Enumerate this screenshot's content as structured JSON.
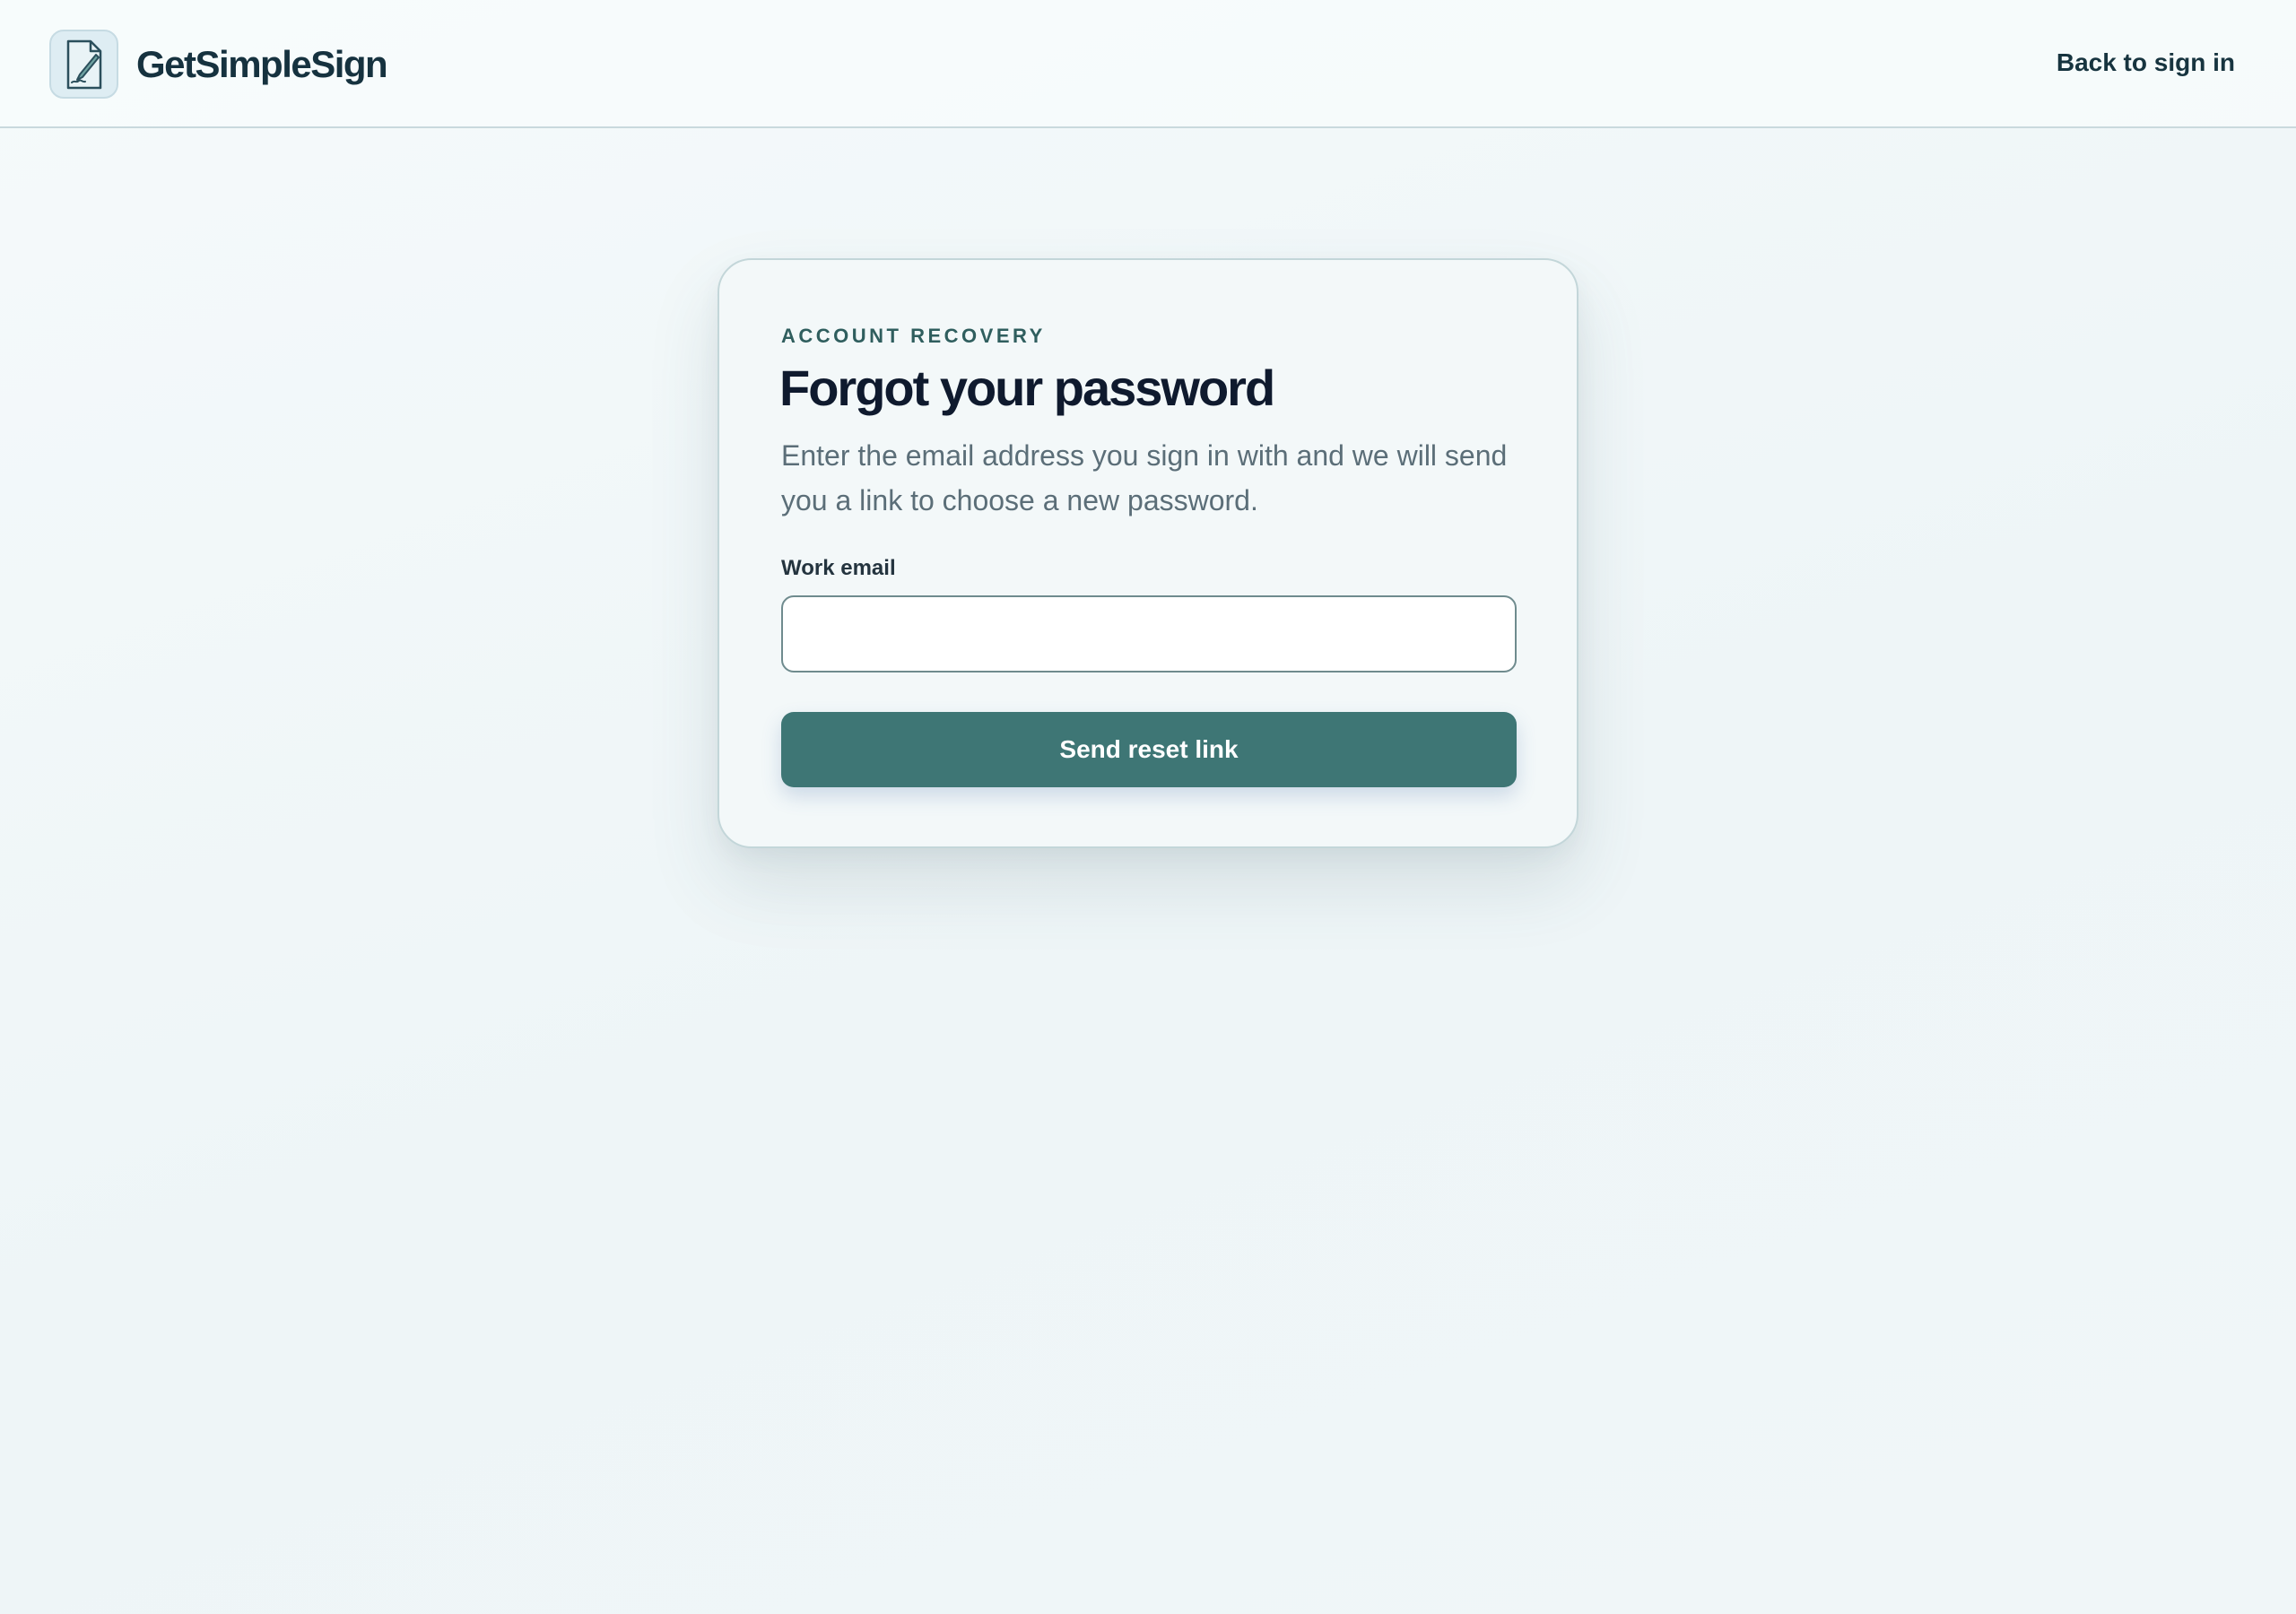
{
  "header": {
    "brand_name": "GetSimpleSign",
    "logo_icon": "document-signature-icon",
    "back_link_label": "Back to sign in"
  },
  "card": {
    "eyebrow": "ACCOUNT RECOVERY",
    "title": "Forgot your password",
    "subtitle": "Enter the email address you sign in with and we will send you a link to choose a new password.",
    "email_label": "Work email",
    "email_value": "",
    "email_placeholder": "",
    "submit_label": "Send reset link"
  },
  "colors": {
    "accent": "#3e7675",
    "eyebrow": "#2f5e5e",
    "title": "#0f1a2e",
    "body_text": "#5b6e78",
    "background": "#f3f8f9"
  }
}
